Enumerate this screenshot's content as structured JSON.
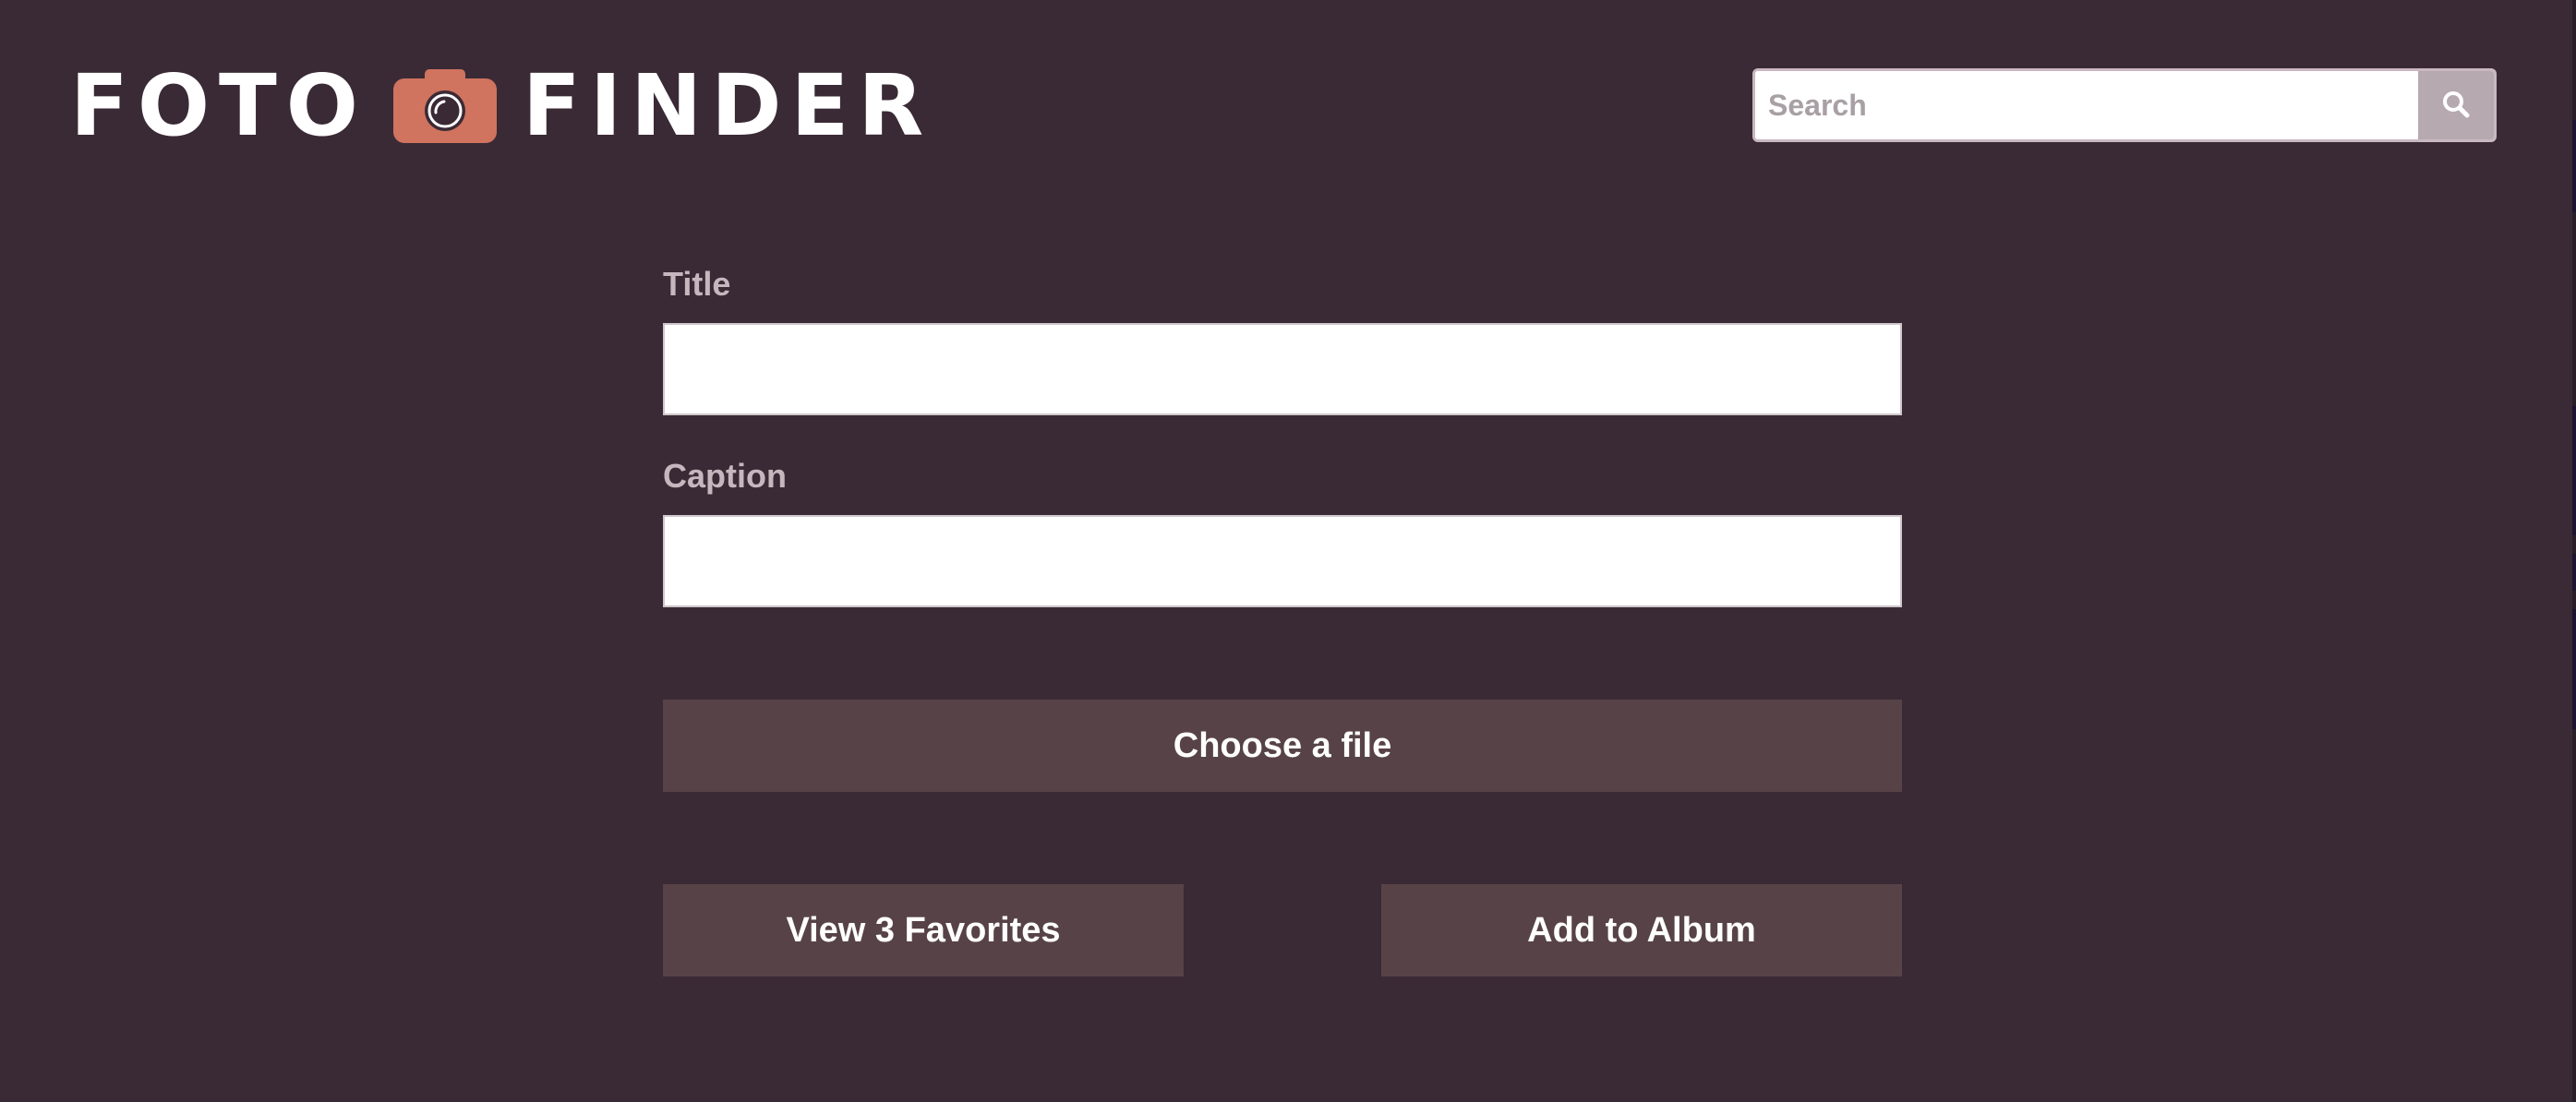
{
  "colors": {
    "background": "#3a2a35",
    "button": "#574347",
    "camera_accent": "#d0735f",
    "label": "#c6b6be",
    "search_button": "#b7a9b0"
  },
  "header": {
    "logo": {
      "word1": "FOTO",
      "word2": "FINDER",
      "icon": "camera-icon"
    },
    "search": {
      "placeholder": "Search",
      "value": "",
      "button_icon": "search-icon"
    }
  },
  "form": {
    "title": {
      "label": "Title",
      "value": ""
    },
    "caption": {
      "label": "Caption",
      "value": ""
    },
    "choose_file_label": "Choose a file",
    "view_favorites_label": "View 3 Favorites",
    "add_to_album_label": "Add to Album"
  }
}
